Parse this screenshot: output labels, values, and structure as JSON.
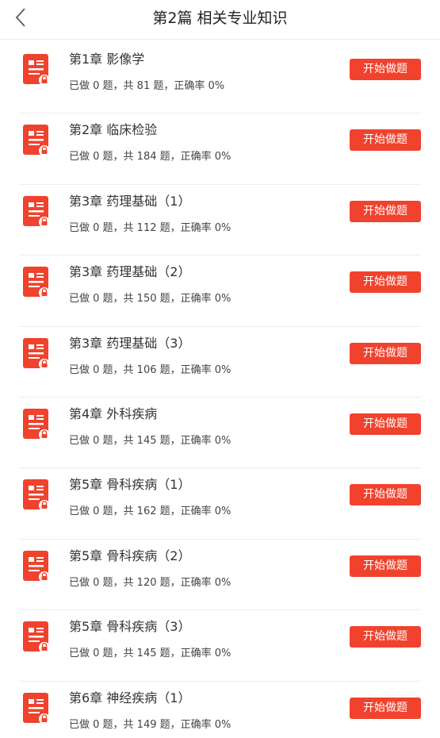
{
  "header": {
    "title": "第2篇 相关专业知识"
  },
  "icons": {
    "back": "chevron-left-icon",
    "chapter": "document-lock-icon"
  },
  "colors": {
    "accent": "#f0422d"
  },
  "chapters": [
    {
      "title": "第1章 影像学",
      "stats": "已做 0 题，共 81 题，正确率 0%",
      "button": "开始做题"
    },
    {
      "title": "第2章 临床检验",
      "stats": "已做 0 题，共 184 题，正确率 0%",
      "button": "开始做题"
    },
    {
      "title": "第3章 药理基础（1）",
      "stats": "已做 0 题，共 112 题，正确率 0%",
      "button": "开始做题"
    },
    {
      "title": "第3章 药理基础（2）",
      "stats": "已做 0 题，共 150 题，正确率 0%",
      "button": "开始做题"
    },
    {
      "title": "第3章 药理基础（3）",
      "stats": "已做 0 题，共 106 题，正确率 0%",
      "button": "开始做题"
    },
    {
      "title": "第4章 外科疾病",
      "stats": "已做 0 题，共 145 题，正确率 0%",
      "button": "开始做题"
    },
    {
      "title": "第5章 骨科疾病（1）",
      "stats": "已做 0 题，共 162 题，正确率 0%",
      "button": "开始做题"
    },
    {
      "title": "第5章 骨科疾病（2）",
      "stats": "已做 0 题，共 120 题，正确率 0%",
      "button": "开始做题"
    },
    {
      "title": "第5章 骨科疾病（3）",
      "stats": "已做 0 题，共 145 题，正确率 0%",
      "button": "开始做题"
    },
    {
      "title": "第6章 神经疾病（1）",
      "stats": "已做 0 题，共 149 题，正确率 0%",
      "button": "开始做题"
    }
  ]
}
